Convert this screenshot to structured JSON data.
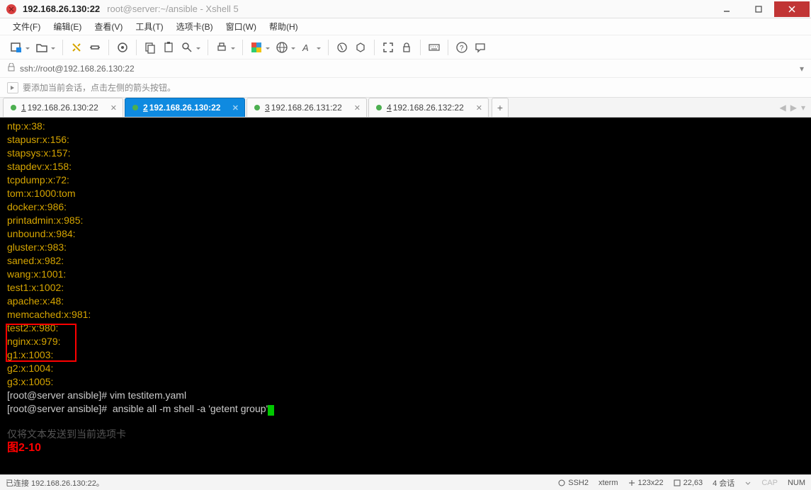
{
  "window": {
    "title_primary": "192.168.26.130:22",
    "title_secondary": "root@server:~/ansible - Xshell 5"
  },
  "menu": {
    "items": [
      "文件(F)",
      "编辑(E)",
      "查看(V)",
      "工具(T)",
      "选项卡(B)",
      "窗口(W)",
      "帮助(H)"
    ]
  },
  "address": {
    "url": "ssh://root@192.168.26.130:22"
  },
  "infobar": {
    "text": "要添加当前会话，点击左侧的箭头按钮。"
  },
  "tabs": [
    {
      "index": "1",
      "label": "192.168.26.130:22",
      "active": false
    },
    {
      "index": "2",
      "label": "192.168.26.130:22",
      "active": true
    },
    {
      "index": "3",
      "label": "192.168.26.131:22",
      "active": false
    },
    {
      "index": "4",
      "label": "192.168.26.132:22",
      "active": false
    }
  ],
  "terminal": {
    "lines_yellow": [
      "ntp:x:38:",
      "stapusr:x:156:",
      "stapsys:x:157:",
      "stapdev:x:158:",
      "tcpdump:x:72:",
      "tom:x:1000:tom",
      "docker:x:986:",
      "printadmin:x:985:",
      "unbound:x:984:",
      "gluster:x:983:",
      "saned:x:982:",
      "wang:x:1001:",
      "test1:x:1002:",
      "apache:x:48:",
      "memcached:x:981:",
      "test2:x:980:",
      "nginx:x:979:",
      "g1:x:1003:",
      "g2:x:1004:",
      "g3:x:1005:"
    ],
    "prompt1": "[root@server ansible]# vim testitem.yaml",
    "prompt2": "[root@server ansible]#  ansible all -m shell -a 'getent group'",
    "fade_text": "仅将文本发送到当前选项卡",
    "annot": "图2-10"
  },
  "statusbar": {
    "connected": "已连接 192.168.26.130:22。",
    "ssh": "SSH2",
    "term": "xterm",
    "size": "123x22",
    "pos": "22,63",
    "sessions": "4 会话",
    "cap": "CAP",
    "num": "NUM"
  }
}
